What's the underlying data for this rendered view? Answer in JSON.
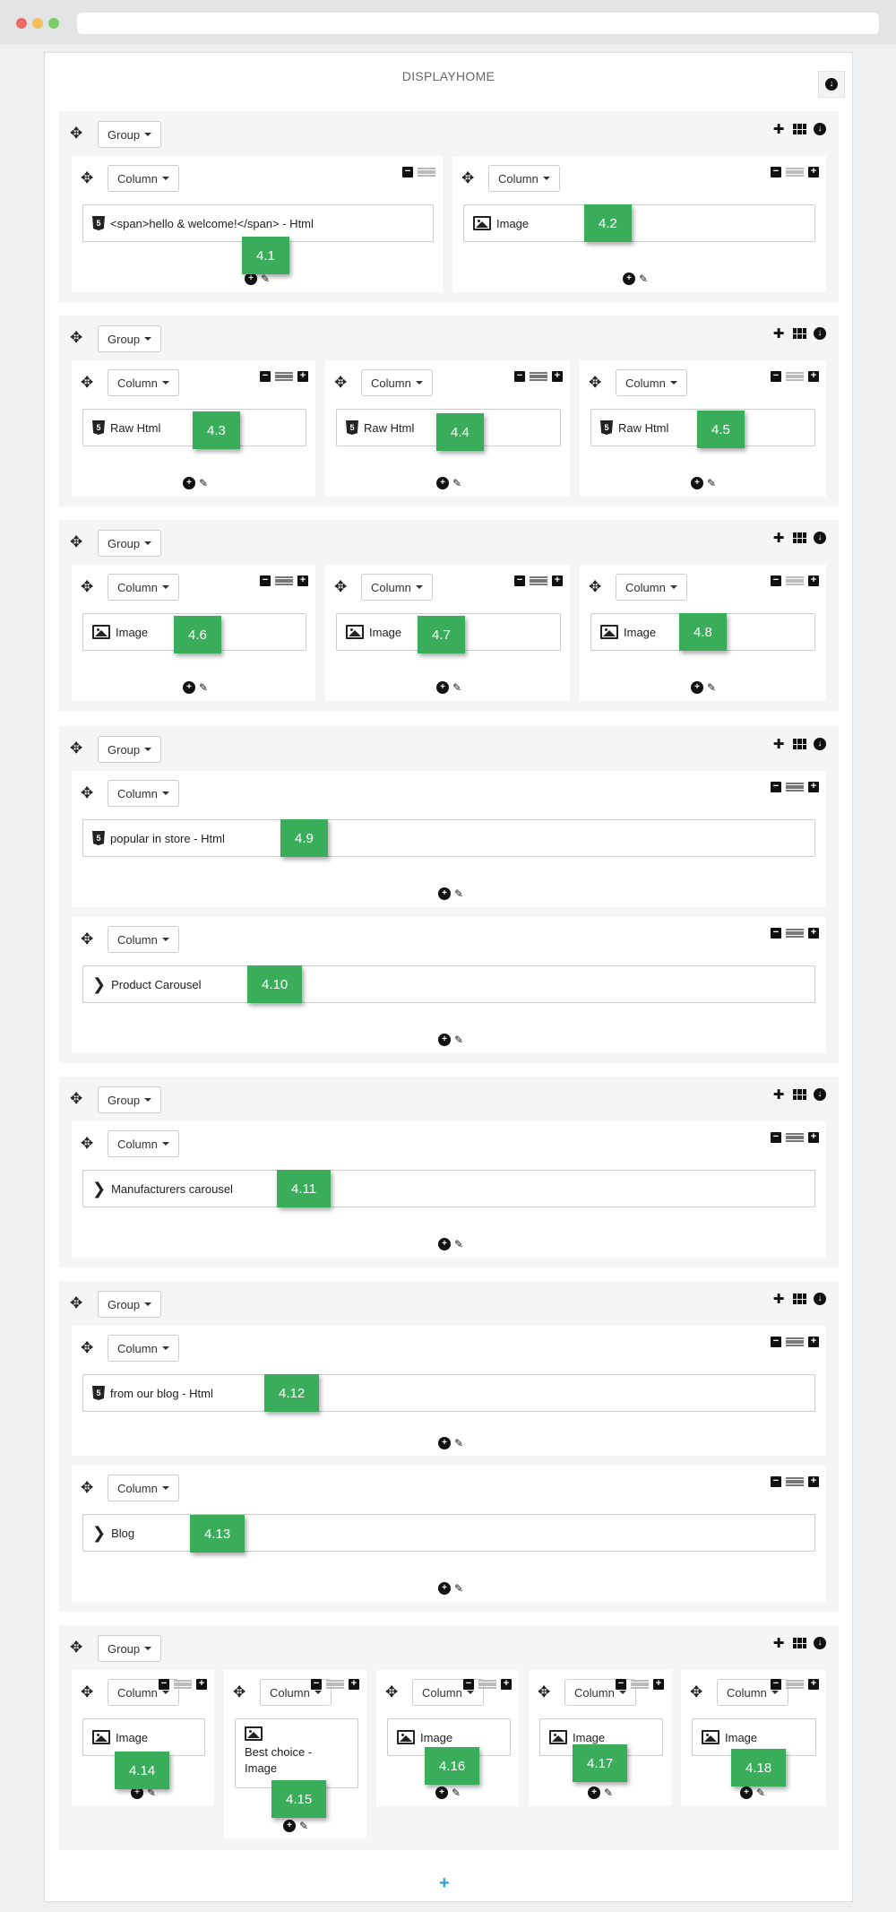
{
  "panel": {
    "title": "DISPLAYHOME"
  },
  "labels": {
    "group": "Group",
    "column": "Column"
  },
  "modules": {
    "m41": "<span>hello & welcome!</span> - Html",
    "m42": "Image",
    "m43": "Raw Html",
    "m44": "Raw Html",
    "m45": "Raw Html",
    "m46": "Image",
    "m47": "Image",
    "m48": "Image",
    "m49": "popular in store - Html",
    "m410": "Product Carousel",
    "m411": "Manufacturers carousel",
    "m412": "from our blog - Html",
    "m413": "Blog",
    "m414": "Image",
    "m415": "Best choice - Image",
    "m416": "Image",
    "m417": "Image",
    "m418": "Image"
  },
  "badges": {
    "b41": "4.1",
    "b42": "4.2",
    "b43": "4.3",
    "b44": "4.4",
    "b45": "4.5",
    "b46": "4.6",
    "b47": "4.7",
    "b48": "4.8",
    "b49": "4.9",
    "b410": "4.10",
    "b411": "4.11",
    "b412": "4.12",
    "b413": "4.13",
    "b414": "4.14",
    "b415": "4.15",
    "b416": "4.16",
    "b417": "4.17",
    "b418": "4.18"
  },
  "icons": {
    "move": "move-arrows-icon",
    "add": "plus-icon",
    "grid": "grid-icon",
    "toggle": "circle-arrow-down-icon",
    "minus": "minus-square-icon",
    "plus": "plus-square-icon",
    "lines": "lines-icon",
    "html": "html5-icon",
    "image": "image-icon",
    "chevron": "chevron-right-icon",
    "pencil": "pencil-icon"
  },
  "colors": {
    "badge": "#3aad5a",
    "accent": "#2aa4d8",
    "group_bg": "#f5f5f5"
  }
}
